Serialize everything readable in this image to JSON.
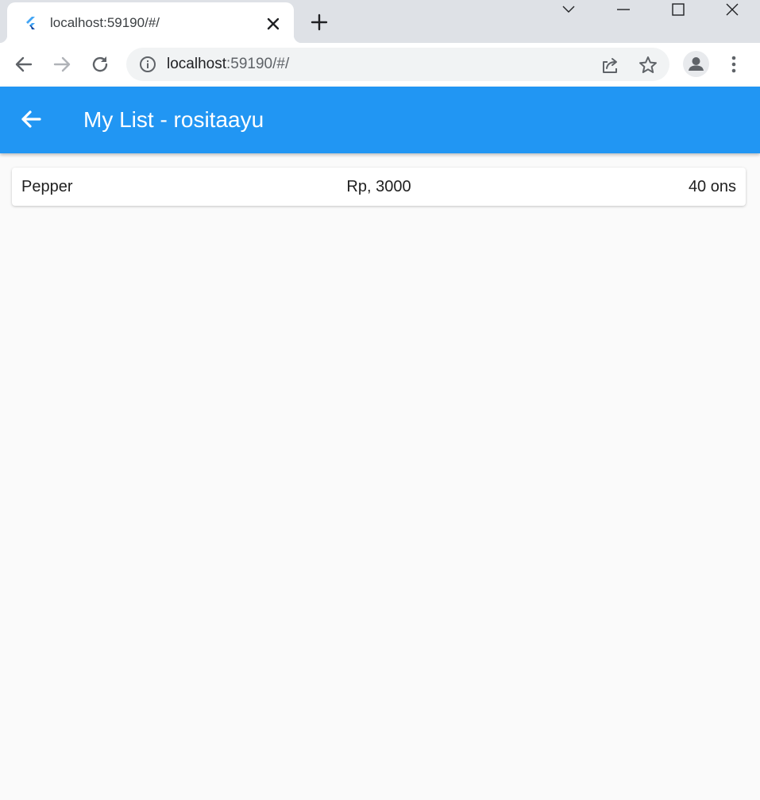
{
  "browser": {
    "tab": {
      "title": "localhost:59190/#/"
    },
    "address": {
      "host": "localhost",
      "rest": ":59190/#/"
    }
  },
  "app": {
    "title": "My List - rositaayu",
    "colors": {
      "appbar": "#2196f3",
      "background": "#fafafa"
    },
    "items": [
      {
        "name": "Pepper",
        "price": "Rp, 3000",
        "quantity": "40 ons"
      }
    ]
  }
}
